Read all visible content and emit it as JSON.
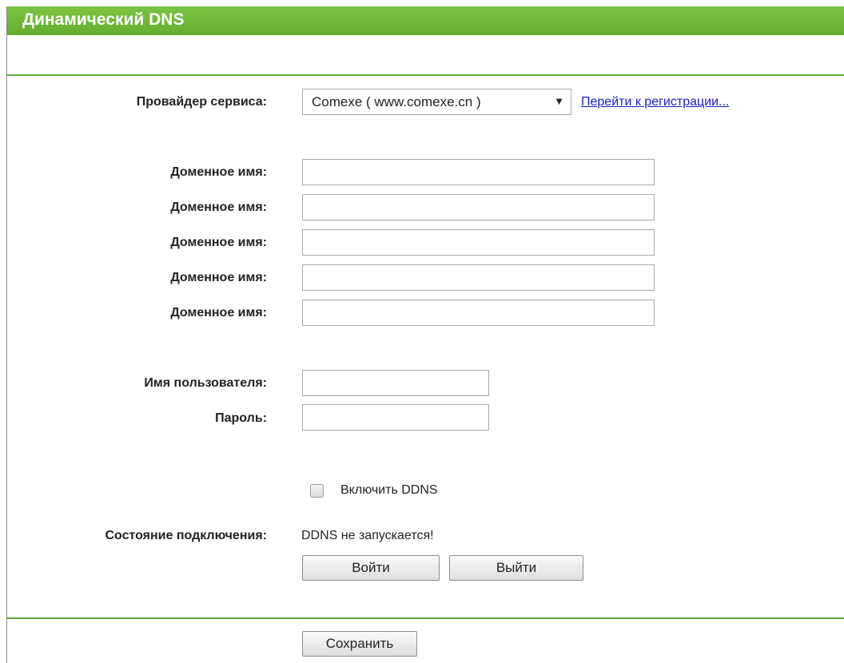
{
  "header": {
    "title": "Динамический DNS"
  },
  "provider": {
    "label": "Провайдер сервиса:",
    "selected": "Comexe ( www.comexe.cn )",
    "arrow": "▼",
    "register_link": "Перейти к регистрации..."
  },
  "domains": {
    "label_1": "Доменное имя:",
    "label_2": "Доменное имя:",
    "label_3": "Доменное имя:",
    "label_4": "Доменное имя:",
    "label_5": "Доменное имя:",
    "value_1": "",
    "value_2": "",
    "value_3": "",
    "value_4": "",
    "value_5": ""
  },
  "account": {
    "username_label": "Имя пользователя:",
    "username_value": "",
    "password_label": "Пароль:",
    "password_value": ""
  },
  "ddns": {
    "enable_label": "Включить DDNS",
    "enabled": false
  },
  "status": {
    "label": "Состояние подключения:",
    "text": "DDNS не запускается!"
  },
  "buttons": {
    "login": "Войти",
    "logout": "Выйти",
    "save": "Сохранить"
  },
  "colors": {
    "header_bg": "#6fbb3a",
    "rule": "#5aa83a",
    "link": "#1c1cc8"
  }
}
